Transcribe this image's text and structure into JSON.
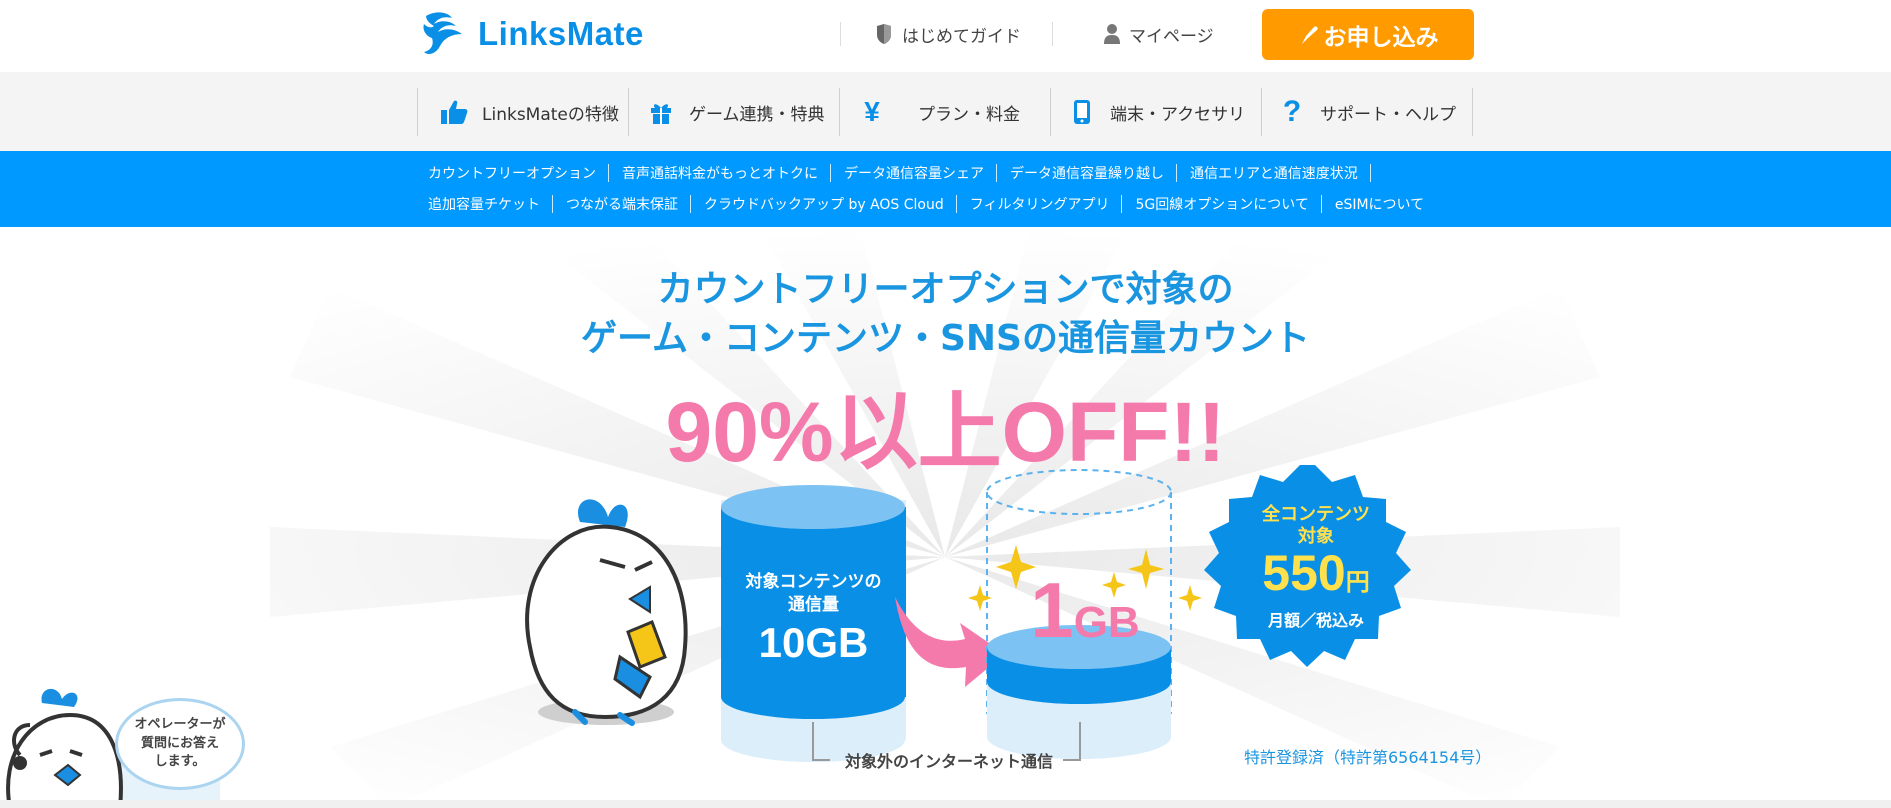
{
  "header": {
    "logo_text": "LinksMate",
    "guide_label": "はじめてガイド",
    "mypage_label": "マイページ",
    "apply_label": "お申し込み"
  },
  "gnav": {
    "items": [
      {
        "label": "LinksMateの特徴",
        "icon": "thumbs-up-icon"
      },
      {
        "label": "ゲーム連携・特典",
        "icon": "gift-icon"
      },
      {
        "label": "プラン・料金",
        "icon": "yen-icon"
      },
      {
        "label": "端末・アクセサリ",
        "icon": "smartphone-icon"
      },
      {
        "label": "サポート・ヘルプ",
        "icon": "question-icon"
      }
    ]
  },
  "subnav": {
    "row1": [
      "カウントフリーオプション",
      "音声通話料金がもっとオトクに",
      "データ通信容量シェア",
      "データ通信容量繰り越し",
      "通信エリアと通信速度状況"
    ],
    "row2": [
      "追加容量チケット",
      "つながる端末保証",
      "クラウドバックアップ by AOS Cloud",
      "フィルタリングアプリ",
      "5G回線オプションについて",
      "eSIMについて"
    ]
  },
  "hero": {
    "line1": "カウントフリーオプションで対象の",
    "line2": "ゲーム・コンテンツ・SNSの通信量カウント",
    "headline": "90%以上OFF!!",
    "left_cylinder_caption1": "対象コンテンツの",
    "left_cylinder_caption2": "通信量",
    "left_cylinder_value": "10GB",
    "right_value_num": "1",
    "right_value_unit": "GB",
    "badge_line1": "全コンテンツ",
    "badge_line2": "対象",
    "badge_price": "550",
    "badge_yen": "円",
    "badge_line3": "月額／税込み",
    "outside_label": "対象外のインターネット通信",
    "patent": "特許登録済（特許第6564154号）"
  },
  "operator": {
    "bubble_line1": "オペレーターが",
    "bubble_line2": "質問にお答え",
    "bubble_line3": "します。"
  },
  "colors": {
    "brand_blue": "#0099ff",
    "apply_orange": "#ff9a00",
    "headline_pink": "#f47aab",
    "text_blue": "#1a95e0"
  }
}
